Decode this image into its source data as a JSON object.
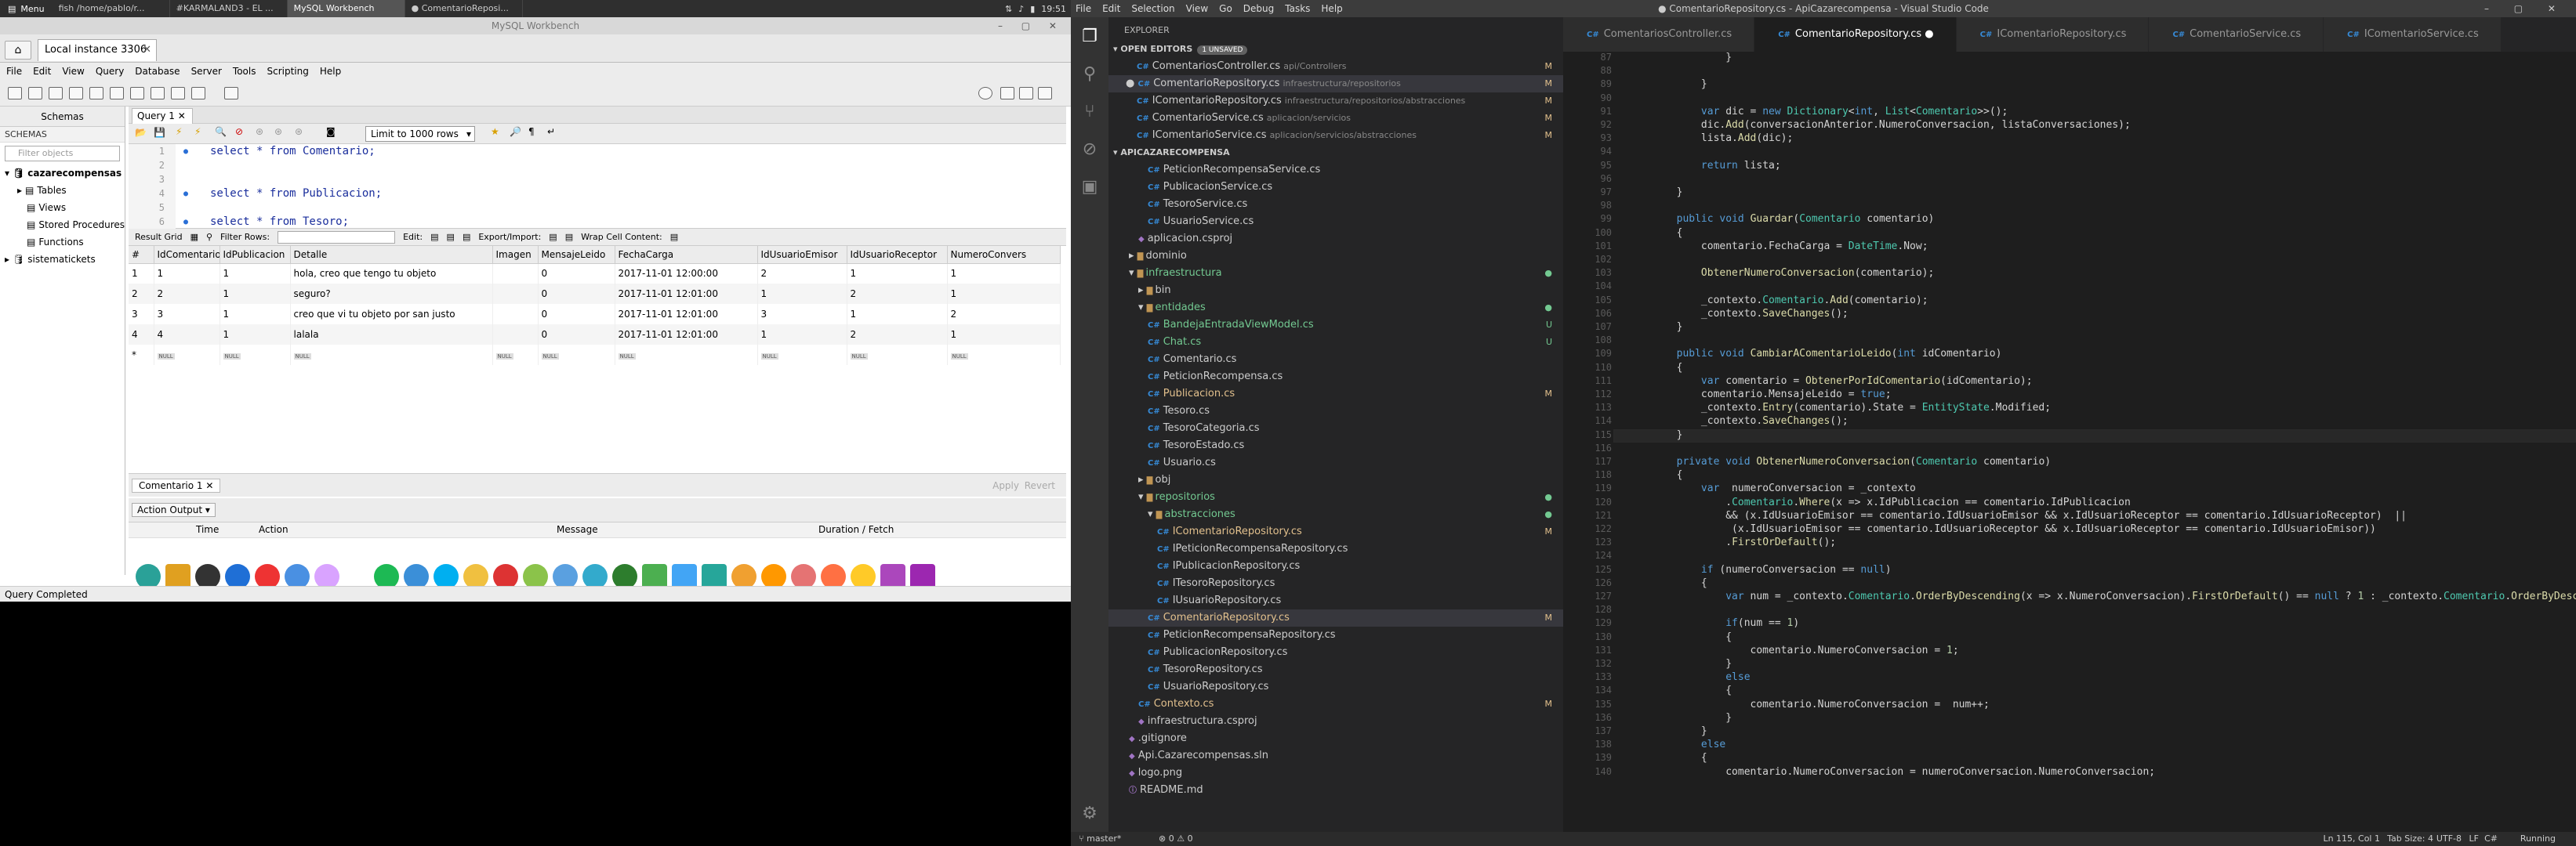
{
  "taskbar": {
    "menu": "Menu",
    "tasks": [
      "fish /home/pablo/r...",
      "#KARMALAND3 - EL ...",
      "MySQL Workbench",
      "● ComentarioReposi..."
    ],
    "clock": "19:51"
  },
  "workbench": {
    "title": "MySQL Workbench",
    "connection_tab": "Local instance 3306",
    "menu": [
      "File",
      "Edit",
      "View",
      "Query",
      "Database",
      "Server",
      "Tools",
      "Scripting",
      "Help"
    ],
    "schemas_header": "Schemas",
    "schemas_label": "SCHEMAS",
    "filter_placeholder": "Filter objects",
    "tree": [
      "cazarecompensas",
      "Tables",
      "Views",
      "Stored Procedures",
      "Functions",
      "sistematickets"
    ],
    "query_tab": "Query 1",
    "limit": "Limit to 1000 rows",
    "sql_lines": [
      "select * from Comentario;",
      "",
      "",
      "select * from Publicacion;",
      "",
      "select * from Tesoro;"
    ],
    "line_numbers": [
      "1",
      "2",
      "3",
      "4",
      "5",
      "6"
    ],
    "result_bar": {
      "result_grid": "Result Grid",
      "filter_rows": "Filter Rows:",
      "edit": "Edit:",
      "export": "Export/Import:",
      "wrap": "Wrap Cell Content:"
    },
    "columns": [
      "#",
      "IdComentario",
      "IdPublicacion",
      "Detalle",
      "Imagen",
      "MensajeLeido",
      "FechaCarga",
      "IdUsuarioEmisor",
      "IdUsuarioReceptor",
      "NumeroConvers"
    ],
    "rows": [
      [
        "1",
        "1",
        "1",
        "hola, creo que tengo tu objeto",
        "",
        "0",
        "2017-11-01 12:00:00",
        "2",
        "1",
        "1"
      ],
      [
        "2",
        "2",
        "1",
        "seguro?",
        "",
        "0",
        "2017-11-01 12:01:00",
        "1",
        "2",
        "1"
      ],
      [
        "3",
        "3",
        "1",
        "creo que vi tu objeto por san justo",
        "",
        "0",
        "2017-11-01 12:01:00",
        "3",
        "1",
        "2"
      ],
      [
        "4",
        "4",
        "1",
        "lalala",
        "",
        "0",
        "2017-11-01 12:01:00",
        "1",
        "2",
        "1"
      ]
    ],
    "null_text": "NULL",
    "bottom_tab": "Comentario 1",
    "apply": "Apply",
    "revert": "Revert",
    "action_output": "Action Output",
    "output_cols": [
      "Time",
      "Action",
      "Message",
      "Duration / Fetch"
    ],
    "status": "Query Completed"
  },
  "vscode": {
    "title": "● ComentarioRepository.cs - ApiCazarecompensa - Visual Studio Code",
    "menu": [
      "File",
      "Edit",
      "Selection",
      "View",
      "Go",
      "Debug",
      "Tasks",
      "Help"
    ],
    "explorer": "EXPLORER",
    "open_editors": "OPEN EDITORS",
    "unsaved": "1 UNSAVED",
    "open_files": [
      {
        "name": "ComentariosController.cs",
        "path": "api/Controllers",
        "stat": "M"
      },
      {
        "name": "ComentarioRepository.cs",
        "path": "infraestructura/repositorios",
        "stat": "M"
      },
      {
        "name": "IComentarioRepository.cs",
        "path": "infraestructura/repositorios/abstracciones",
        "stat": "M"
      },
      {
        "name": "ComentarioService.cs",
        "path": "aplicacion/servicios",
        "stat": "M"
      },
      {
        "name": "IComentarioService.cs",
        "path": "aplicacion/servicios/abstracciones",
        "stat": "M"
      }
    ],
    "project": "APICAZARECOMPENSA",
    "tree": [
      {
        "label": "PeticionRecompensaService.cs",
        "stat": ""
      },
      {
        "label": "PublicacionService.cs",
        "stat": ""
      },
      {
        "label": "TesoroService.cs",
        "stat": ""
      },
      {
        "label": "UsuarioService.cs",
        "stat": ""
      },
      {
        "label": "aplicacion.csproj",
        "stat": ""
      },
      {
        "label": "dominio",
        "stat": ""
      },
      {
        "label": "infraestructura",
        "stat": "●"
      },
      {
        "label": "bin",
        "stat": ""
      },
      {
        "label": "entidades",
        "stat": "●"
      },
      {
        "label": "BandejaEntradaViewModel.cs",
        "stat": "U"
      },
      {
        "label": "Chat.cs",
        "stat": "U"
      },
      {
        "label": "Comentario.cs",
        "stat": ""
      },
      {
        "label": "PeticionRecompensa.cs",
        "stat": ""
      },
      {
        "label": "Publicacion.cs",
        "stat": "M"
      },
      {
        "label": "Tesoro.cs",
        "stat": ""
      },
      {
        "label": "TesoroCategoria.cs",
        "stat": ""
      },
      {
        "label": "TesoroEstado.cs",
        "stat": ""
      },
      {
        "label": "Usuario.cs",
        "stat": ""
      },
      {
        "label": "obj",
        "stat": ""
      },
      {
        "label": "repositorios",
        "stat": "●"
      },
      {
        "label": "abstracciones",
        "stat": "●"
      },
      {
        "label": "IComentarioRepository.cs",
        "stat": "M"
      },
      {
        "label": "IPeticionRecompensaRepository.cs",
        "stat": ""
      },
      {
        "label": "IPublicacionRepository.cs",
        "stat": ""
      },
      {
        "label": "ITesoroRepository.cs",
        "stat": ""
      },
      {
        "label": "IUsuarioRepository.cs",
        "stat": ""
      },
      {
        "label": "ComentarioRepository.cs",
        "stat": "M"
      },
      {
        "label": "PeticionRecompensaRepository.cs",
        "stat": ""
      },
      {
        "label": "PublicacionRepository.cs",
        "stat": ""
      },
      {
        "label": "TesoroRepository.cs",
        "stat": ""
      },
      {
        "label": "UsuarioRepository.cs",
        "stat": ""
      },
      {
        "label": "Contexto.cs",
        "stat": "M"
      },
      {
        "label": "infraestructura.csproj",
        "stat": ""
      },
      {
        "label": ".gitignore",
        "stat": ""
      },
      {
        "label": "Api.Cazarecompensas.sln",
        "stat": ""
      },
      {
        "label": "logo.png",
        "stat": ""
      },
      {
        "label": "README.md",
        "stat": ""
      }
    ],
    "tabs": [
      "ComentariosController.cs",
      "ComentarioRepository.cs",
      "IComentarioRepository.cs",
      "ComentarioService.cs",
      "IComentarioService.cs"
    ],
    "first_line": 87,
    "code": [
      "                }",
      "",
      "            }",
      "",
      "            var dic = new Dictionary<int, List<Comentario>>();",
      "            dic.Add(conversacionAnterior.NumeroConversacion, listaConversaciones);",
      "            lista.Add(dic);",
      "",
      "            return lista;",
      "",
      "        }",
      "",
      "        public void Guardar(Comentario comentario)",
      "        {",
      "            comentario.FechaCarga = DateTime.Now;",
      "",
      "            ObtenerNumeroConversacion(comentario);",
      "",
      "            _contexto.Comentario.Add(comentario);",
      "            _contexto.SaveChanges();",
      "        }",
      "",
      "        public void CambiarAComentarioLeido(int idComentario)",
      "        {",
      "            var comentario = ObtenerPorIdComentario(idComentario);",
      "            comentario.MensajeLeido = true;",
      "            _contexto.Entry(comentario).State = EntityState.Modified;",
      "            _contexto.SaveChanges();",
      "        }",
      "",
      "        private void ObtenerNumeroConversacion(Comentario comentario)",
      "        {",
      "            var  numeroConversacion = _contexto",
      "                .Comentario.Where(x => x.IdPublicacion == comentario.IdPublicacion",
      "                && (x.IdUsuarioEmisor == comentario.IdUsuarioEmisor && x.IdUsuarioReceptor == comentario.IdUsuarioReceptor)  ||",
      "                 (x.IdUsuarioEmisor == comentario.IdUsuarioReceptor && x.IdUsuarioReceptor == comentario.IdUsuarioEmisor))",
      "                .FirstOrDefault();",
      "",
      "            if (numeroConversacion == null)",
      "            {",
      "                var num = _contexto.Comentario.OrderByDescending(x => x.NumeroConversacion).FirstOrDefault() == null ? 1 : _contexto.Comentario.OrderByDesc",
      "",
      "                if(num == 1)",
      "                {",
      "                    comentario.NumeroConversacion = 1;",
      "                }",
      "                else",
      "                {",
      "                    comentario.NumeroConversacion =  num++;",
      "                }",
      "            }",
      "            else",
      "            {",
      "                comentario.NumeroConversacion = numeroConversacion.NumeroConversacion;"
    ],
    "status_left": [
      "master*",
      "⊗ 0 ⚠ 0"
    ],
    "status_right": [
      "Ln 115, Col 1",
      "Tab Size: 4",
      "UTF-8",
      "LF",
      "C#",
      "Running"
    ]
  }
}
